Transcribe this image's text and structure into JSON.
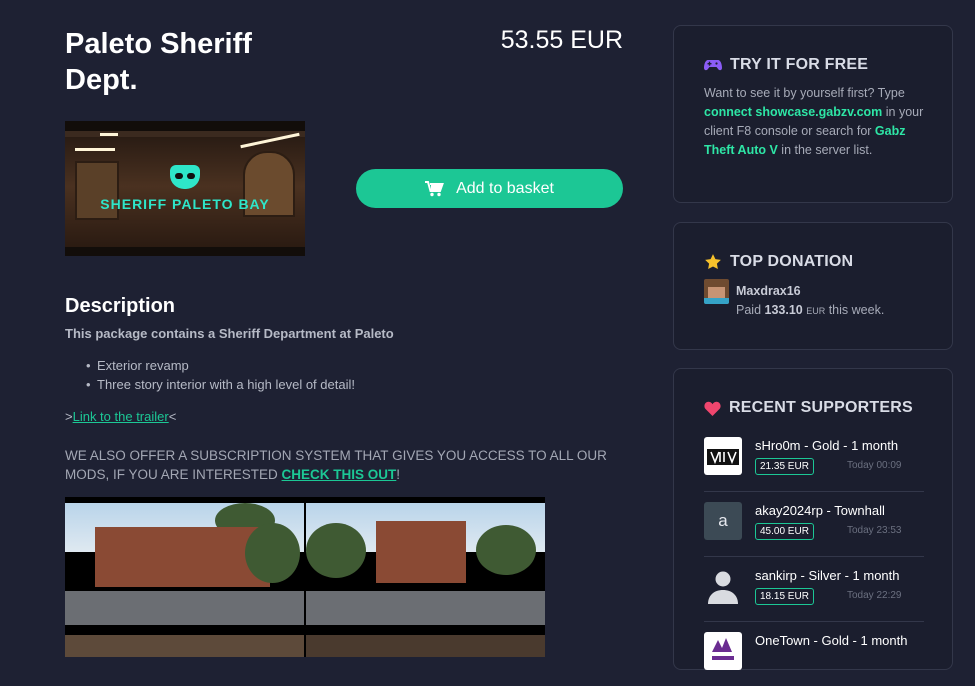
{
  "product": {
    "title": "Paleto Sheriff Dept.",
    "price": "53.55 EUR",
    "image_text": "SHERIFF PALETO BAY",
    "basket_label": "Add to basket"
  },
  "description": {
    "heading": "Description",
    "subtitle": "This package contains a Sheriff Department at Paleto",
    "bullets": [
      "Exterior revamp",
      "Three story interior with a high level of detail!"
    ],
    "trailer_prefix": ">",
    "trailer_link": "Link to the trailer",
    "trailer_suffix": "<",
    "offer_text": "WE ALSO OFFER A SUBSCRIPTION SYSTEM THAT GIVES YOU ACCESS TO ALL OUR MODS, IF YOU ARE INTERESTED ",
    "offer_link": "CHECK THIS OUT",
    "offer_end": "!"
  },
  "try_free": {
    "title": "TRY IT FOR FREE",
    "icon": "gamepad-icon",
    "text1": "Want to see it by yourself first? Type ",
    "cmd": "connect showcase.gabzv.com",
    "text2": " in your client F8 console or search for ",
    "server": "Gabz Theft Auto V",
    "text3": " in the server list."
  },
  "top_donation": {
    "title": "TOP DONATION",
    "icon": "star-icon",
    "name": "Maxdrax16",
    "paid_prefix": "Paid ",
    "amount": "133.10",
    "currency": "EUR",
    "suffix": " this week."
  },
  "recent": {
    "title": "RECENT SUPPORTERS",
    "icon": "heart-icon",
    "items": [
      {
        "name": "sHro0m - Gold - 1 month",
        "price": "21.35 EUR",
        "time": "Today 00:09",
        "avatar": "logo"
      },
      {
        "name": "akay2024rp - Townhall",
        "price": "45.00 EUR",
        "time": "Today 23:53",
        "avatar": "a"
      },
      {
        "name": "sankirp - Silver - 1 month",
        "price": "18.15 EUR",
        "time": "Today 22:29",
        "avatar": "person"
      },
      {
        "name": "OneTown - Gold - 1 month",
        "price": "",
        "time": "",
        "avatar": "logo2"
      }
    ]
  },
  "colors": {
    "accent": "#1cc795",
    "background": "#1e2133",
    "card": "#1b1e2e"
  }
}
